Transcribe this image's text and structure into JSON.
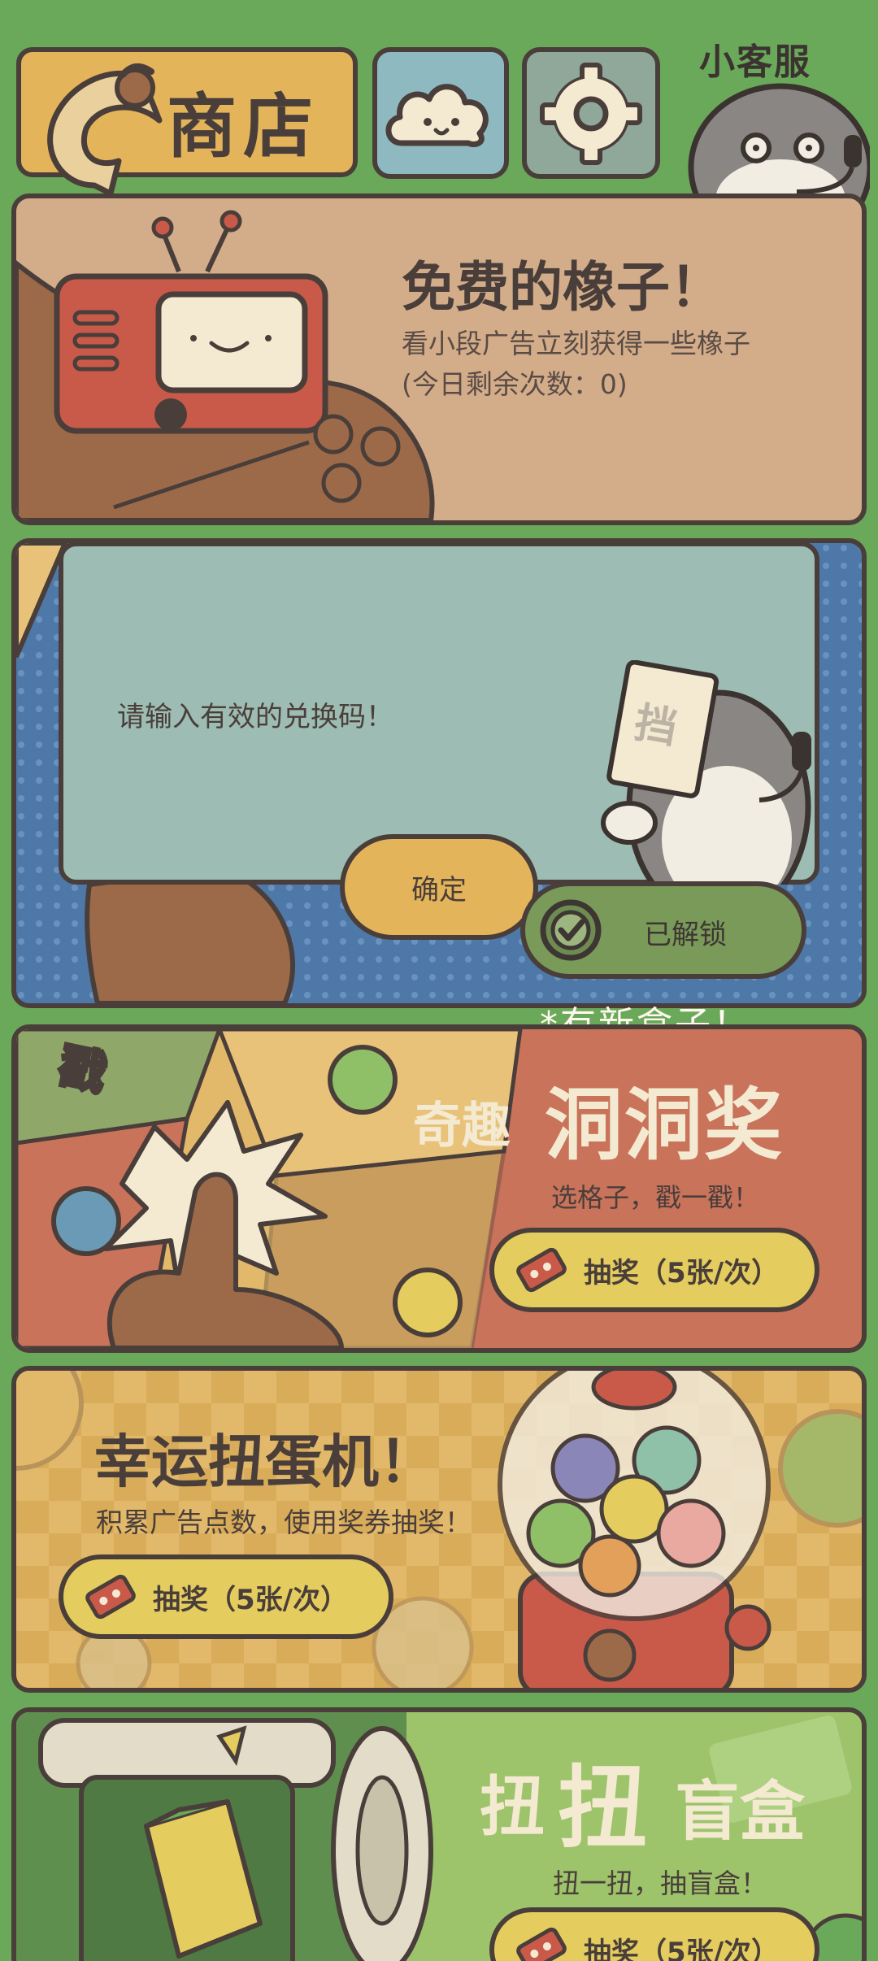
{
  "header": {
    "shop_label": "商店",
    "support_label": "小客服"
  },
  "free_acorns": {
    "title": "免费的橡子！",
    "description": "看小段广告立刻获得一些橡子",
    "remaining": "(今日剩余次数：0)"
  },
  "dialog": {
    "message": "请输入有效的兑换码！",
    "confirm_label": "确定"
  },
  "redeem": {
    "unlocked_label": "已解锁",
    "new_box_note": "*有新盒子！"
  },
  "holes": {
    "title_small": "奇趣",
    "title_large": "洞洞奖",
    "subtitle": "选格子，戳一戳！",
    "draw_label": "抽奖（5张/次）",
    "poke_label": "戳"
  },
  "capsule": {
    "title": "幸运扭蛋机！",
    "subtitle": "积累广告点数，使用奖券抽奖！",
    "draw_label": "抽奖（5张/次）"
  },
  "blind_box": {
    "title_a": "扭",
    "title_b": "扭",
    "title_c": "盲盒",
    "subtitle": "扭一扭，抽盲盒！",
    "draw_label": "抽奖（5张/次）"
  },
  "colors": {
    "background": "#6aa85a",
    "outline": "#4a3e3a",
    "shop_button": "#e3b45a",
    "free_card": "#d3ad8a",
    "redeem_card": "#4e78a8",
    "dialog": "#9dbcb3",
    "holes_card": "#c9735b",
    "capsule_card": "#e2b96a",
    "blind_card": "#9dc36b",
    "draw_button": "#e4cd5e"
  }
}
